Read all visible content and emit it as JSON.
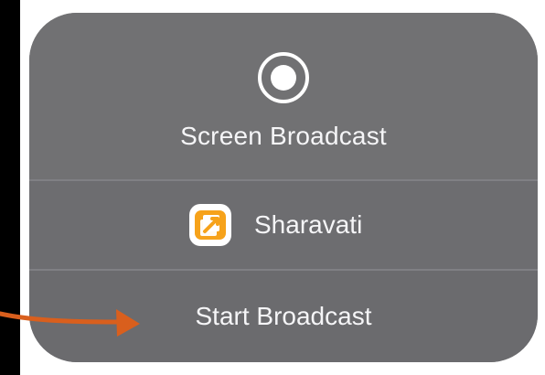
{
  "panel": {
    "title": "Screen Broadcast",
    "app_name": "Sharavati",
    "start_label": "Start Broadcast"
  },
  "icons": {
    "broadcast": "record-icon",
    "app": "sharavati-app-icon"
  },
  "colors": {
    "annotation_arrow": "#d95f1d",
    "panel_background": "#717173",
    "app_icon_orange": "#f6a21a"
  }
}
